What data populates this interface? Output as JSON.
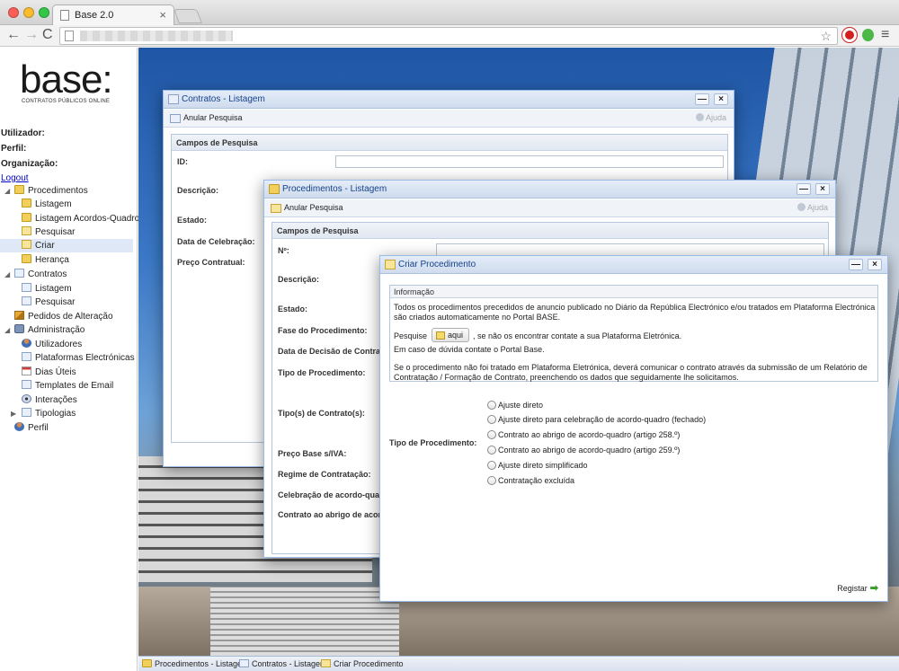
{
  "browser": {
    "tab_title": "Base 2.0",
    "tab_close": "×",
    "back": "←",
    "forward": "→",
    "reload": "C",
    "star": "☆",
    "menu": "≡"
  },
  "sidebar": {
    "logo": "base:",
    "logo_sub": "CONTRATOS PÚBLICOS ONLINE",
    "user_label": "Utilizador:",
    "profile_label": "Perfil:",
    "org_label": "Organização:",
    "logout": "Logout",
    "items": [
      {
        "label": "Procedimentos"
      },
      {
        "label": "Listagem"
      },
      {
        "label": "Listagem Acordos-Quadro"
      },
      {
        "label": "Pesquisar"
      },
      {
        "label": "Criar"
      },
      {
        "label": "Herança"
      },
      {
        "label": "Contratos"
      },
      {
        "label": "Listagem"
      },
      {
        "label": "Pesquisar"
      },
      {
        "label": "Pedidos de Alteração"
      },
      {
        "label": "Administração"
      },
      {
        "label": "Utilizadores"
      },
      {
        "label": "Plataformas Electrónicas"
      },
      {
        "label": "Dias Úteis"
      },
      {
        "label": "Templates de Email"
      },
      {
        "label": "Interações"
      },
      {
        "label": "Tipologias"
      },
      {
        "label": "Perfil"
      }
    ]
  },
  "win_contratos": {
    "title": "Contratos - Listagem",
    "minimize": "—",
    "close": "×",
    "toolbar_action": "Anular Pesquisa",
    "help": "Ajuda",
    "section": "Campos de Pesquisa",
    "fields": [
      "ID:",
      "Descrição:",
      "Estado:",
      "Data de Celebração:",
      "Preço Contratual:"
    ]
  },
  "win_procedimentos": {
    "title": "Procedimentos - Listagem",
    "minimize": "—",
    "close": "×",
    "toolbar_action": "Anular Pesquisa",
    "help": "Ajuda",
    "section": "Campos de Pesquisa",
    "fields": [
      "Nº:",
      "Descrição:",
      "Estado:",
      "Fase do Procedimento:",
      "Data de Decisão de Contrata",
      "Tipo de Procedimento:",
      "Tipo(s) de Contrato(s):",
      "Preço Base s/IVA:",
      "Regime de Contratação:",
      "Celebração de acordo-quadr",
      "Contrato ao abrigo de acordo"
    ]
  },
  "win_criar": {
    "title": "Criar Procedimento",
    "minimize": "—",
    "close": "×",
    "info_header": "Informação",
    "info_p1_l1": "Todos os procedimentos precedidos de anuncio publicado no Diário da República Electrónico e/ou tratados em Plataforma Electrónica",
    "info_p1_l2": "são criados automaticamente no Portal BASE.",
    "pesquise": "Pesquise",
    "aqui": "aqui",
    "info_p2_rest": ", se não os encontrar contate a sua Plataforma Eletrónica.",
    "info_p2_l2": "Em caso de dúvida contate o Portal Base.",
    "info_p3_l1": "Se o procedimento não foi tratado em Plataforma Eletrónica, deverá comunicar o contrato através da submissão de um Relatório de",
    "info_p3_l2": "Contratação / Formação de Contrato, preenchendo os dados que seguidamente lhe solicitamos.",
    "tipo_label": "Tipo de Procedimento:",
    "options": [
      "Ajuste direto",
      "Ajuste direto para celebração de acordo-quadro (fechado)",
      "Contrato ao abrigo de acordo-quadro (artigo 258.º)",
      "Contrato ao abrigo de acordo-quadro (artigo 259.º)",
      "Ajuste direto simplificado",
      "Contratação excluída"
    ],
    "register": "Registar",
    "register_arrow": "➡"
  },
  "taskbar": {
    "items": [
      "Procedimentos - Listagem",
      "Contratos - Listagem",
      "Criar Procedimento"
    ]
  }
}
